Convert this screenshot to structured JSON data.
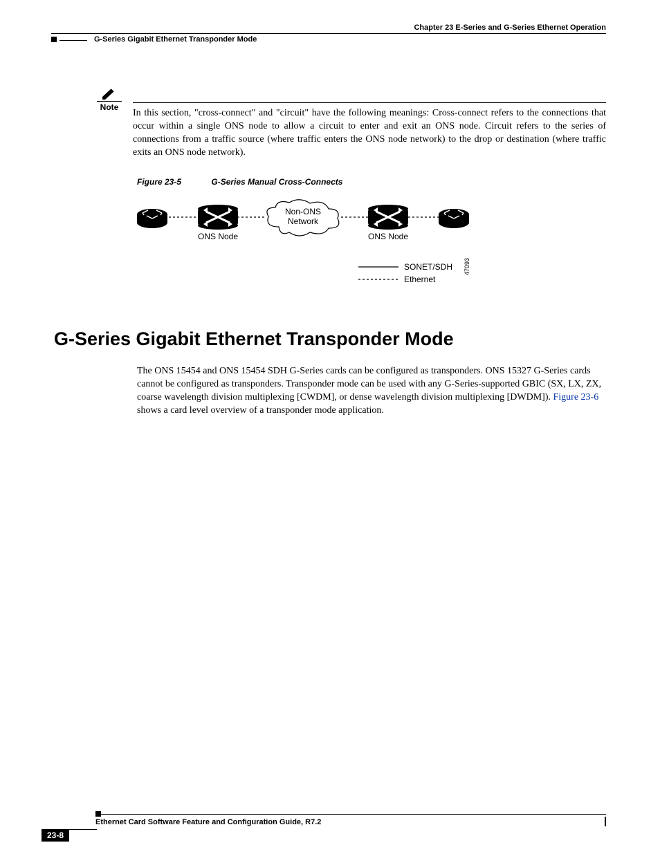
{
  "header": {
    "chapter_line": "Chapter 23 E-Series and G-Series Ethernet Operation",
    "section_line": "G-Series Gigabit Ethernet Transponder Mode"
  },
  "note": {
    "label": "Note",
    "body": "In this section, \"cross-connect\" and \"circuit\" have the following meanings: Cross-connect refers to the connections that occur within a single ONS node to allow a circuit to enter and exit an ONS node. Circuit refers to the series of connections from a traffic source (where traffic enters the ONS node network) to the drop or destination (where traffic exits an ONS node network)."
  },
  "figure": {
    "number": "Figure 23-5",
    "title": "G-Series Manual Cross-Connects",
    "labels": {
      "ons_node_left": "ONS Node",
      "ons_node_right": "ONS Node",
      "cloud_line1": "Non-ONS",
      "cloud_line2": "Network",
      "legend_sonet": "SONET/SDH",
      "legend_ethernet": "Ethernet",
      "id": "47093"
    }
  },
  "heading": {
    "h1": "G-Series Gigabit Ethernet Transponder Mode"
  },
  "paragraph": {
    "pre": "The ONS 15454 and ONS 15454 SDH G-Series cards can be configured as transponders. ONS 15327 G-Series cards cannot be configured as transponders. Transponder mode can be used with any G-Series-supported GBIC (SX, LX, ZX, coarse wavelength division multiplexing [CWDM], or dense wavelength division multiplexing [DWDM]). ",
    "xref": "Figure 23-6",
    "post": " shows a card level overview of a transponder mode application."
  },
  "footer": {
    "title": "Ethernet Card Software Feature and Configuration Guide, R7.2",
    "page": "23-8"
  }
}
